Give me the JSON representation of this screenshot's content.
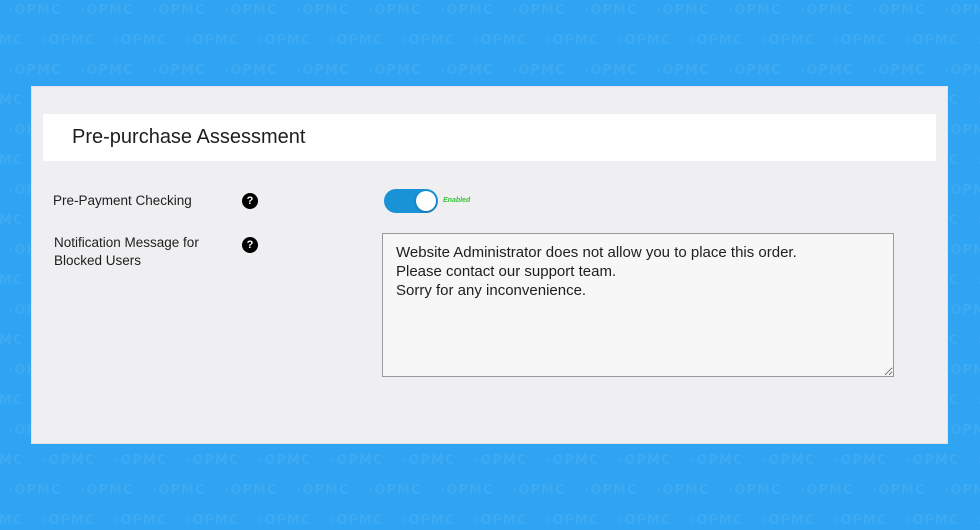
{
  "background": {
    "color": "#2fa4f2",
    "watermark_text": "OPMC"
  },
  "panel": {
    "title": "Pre-purchase Assessment"
  },
  "settings": {
    "prepayment": {
      "label": "Pre-Payment Checking",
      "help": "?",
      "enabled": true,
      "state_label": "Enabled",
      "toggle_color": "#1a92d6"
    },
    "notification": {
      "label": "Notification Message for\nBlocked Users",
      "help": "?",
      "message": "Website Administrator does not allow you to place this order.\nPlease contact our support team.\nSorry for any inconvenience."
    }
  }
}
